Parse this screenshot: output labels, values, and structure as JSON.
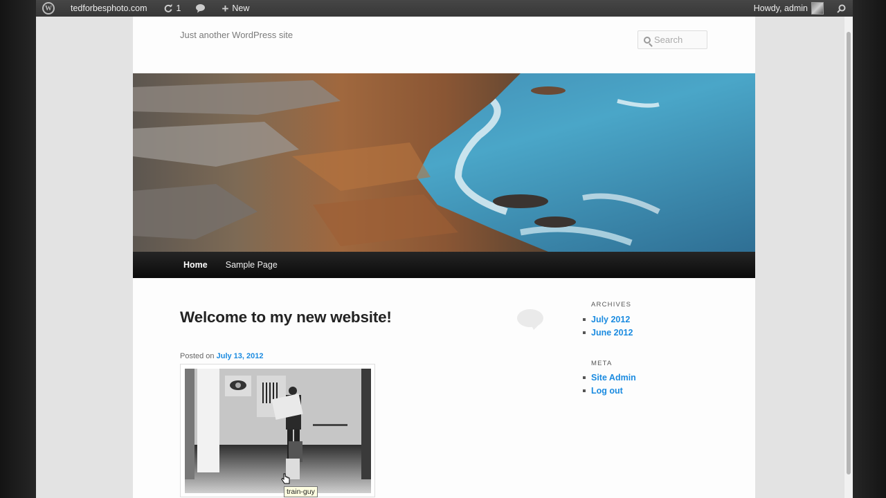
{
  "adminbar": {
    "site_name": "tedforbesphoto.com",
    "updates_count": "1",
    "new_label": "New",
    "howdy": "Howdy, admin"
  },
  "site": {
    "tagline": "Just another WordPress site",
    "search_placeholder": "Search"
  },
  "nav": {
    "items": [
      "Home",
      "Sample Page"
    ]
  },
  "post": {
    "title": "Welcome to my new website!",
    "posted_on": "Posted on",
    "date": "July 13, 2012",
    "image_tooltip": "train-guy"
  },
  "sidebar": {
    "archives_title": "ARCHIVES",
    "archives": [
      "July 2012",
      "June 2012"
    ],
    "meta_title": "META",
    "meta": [
      "Site Admin",
      "Log out"
    ]
  }
}
